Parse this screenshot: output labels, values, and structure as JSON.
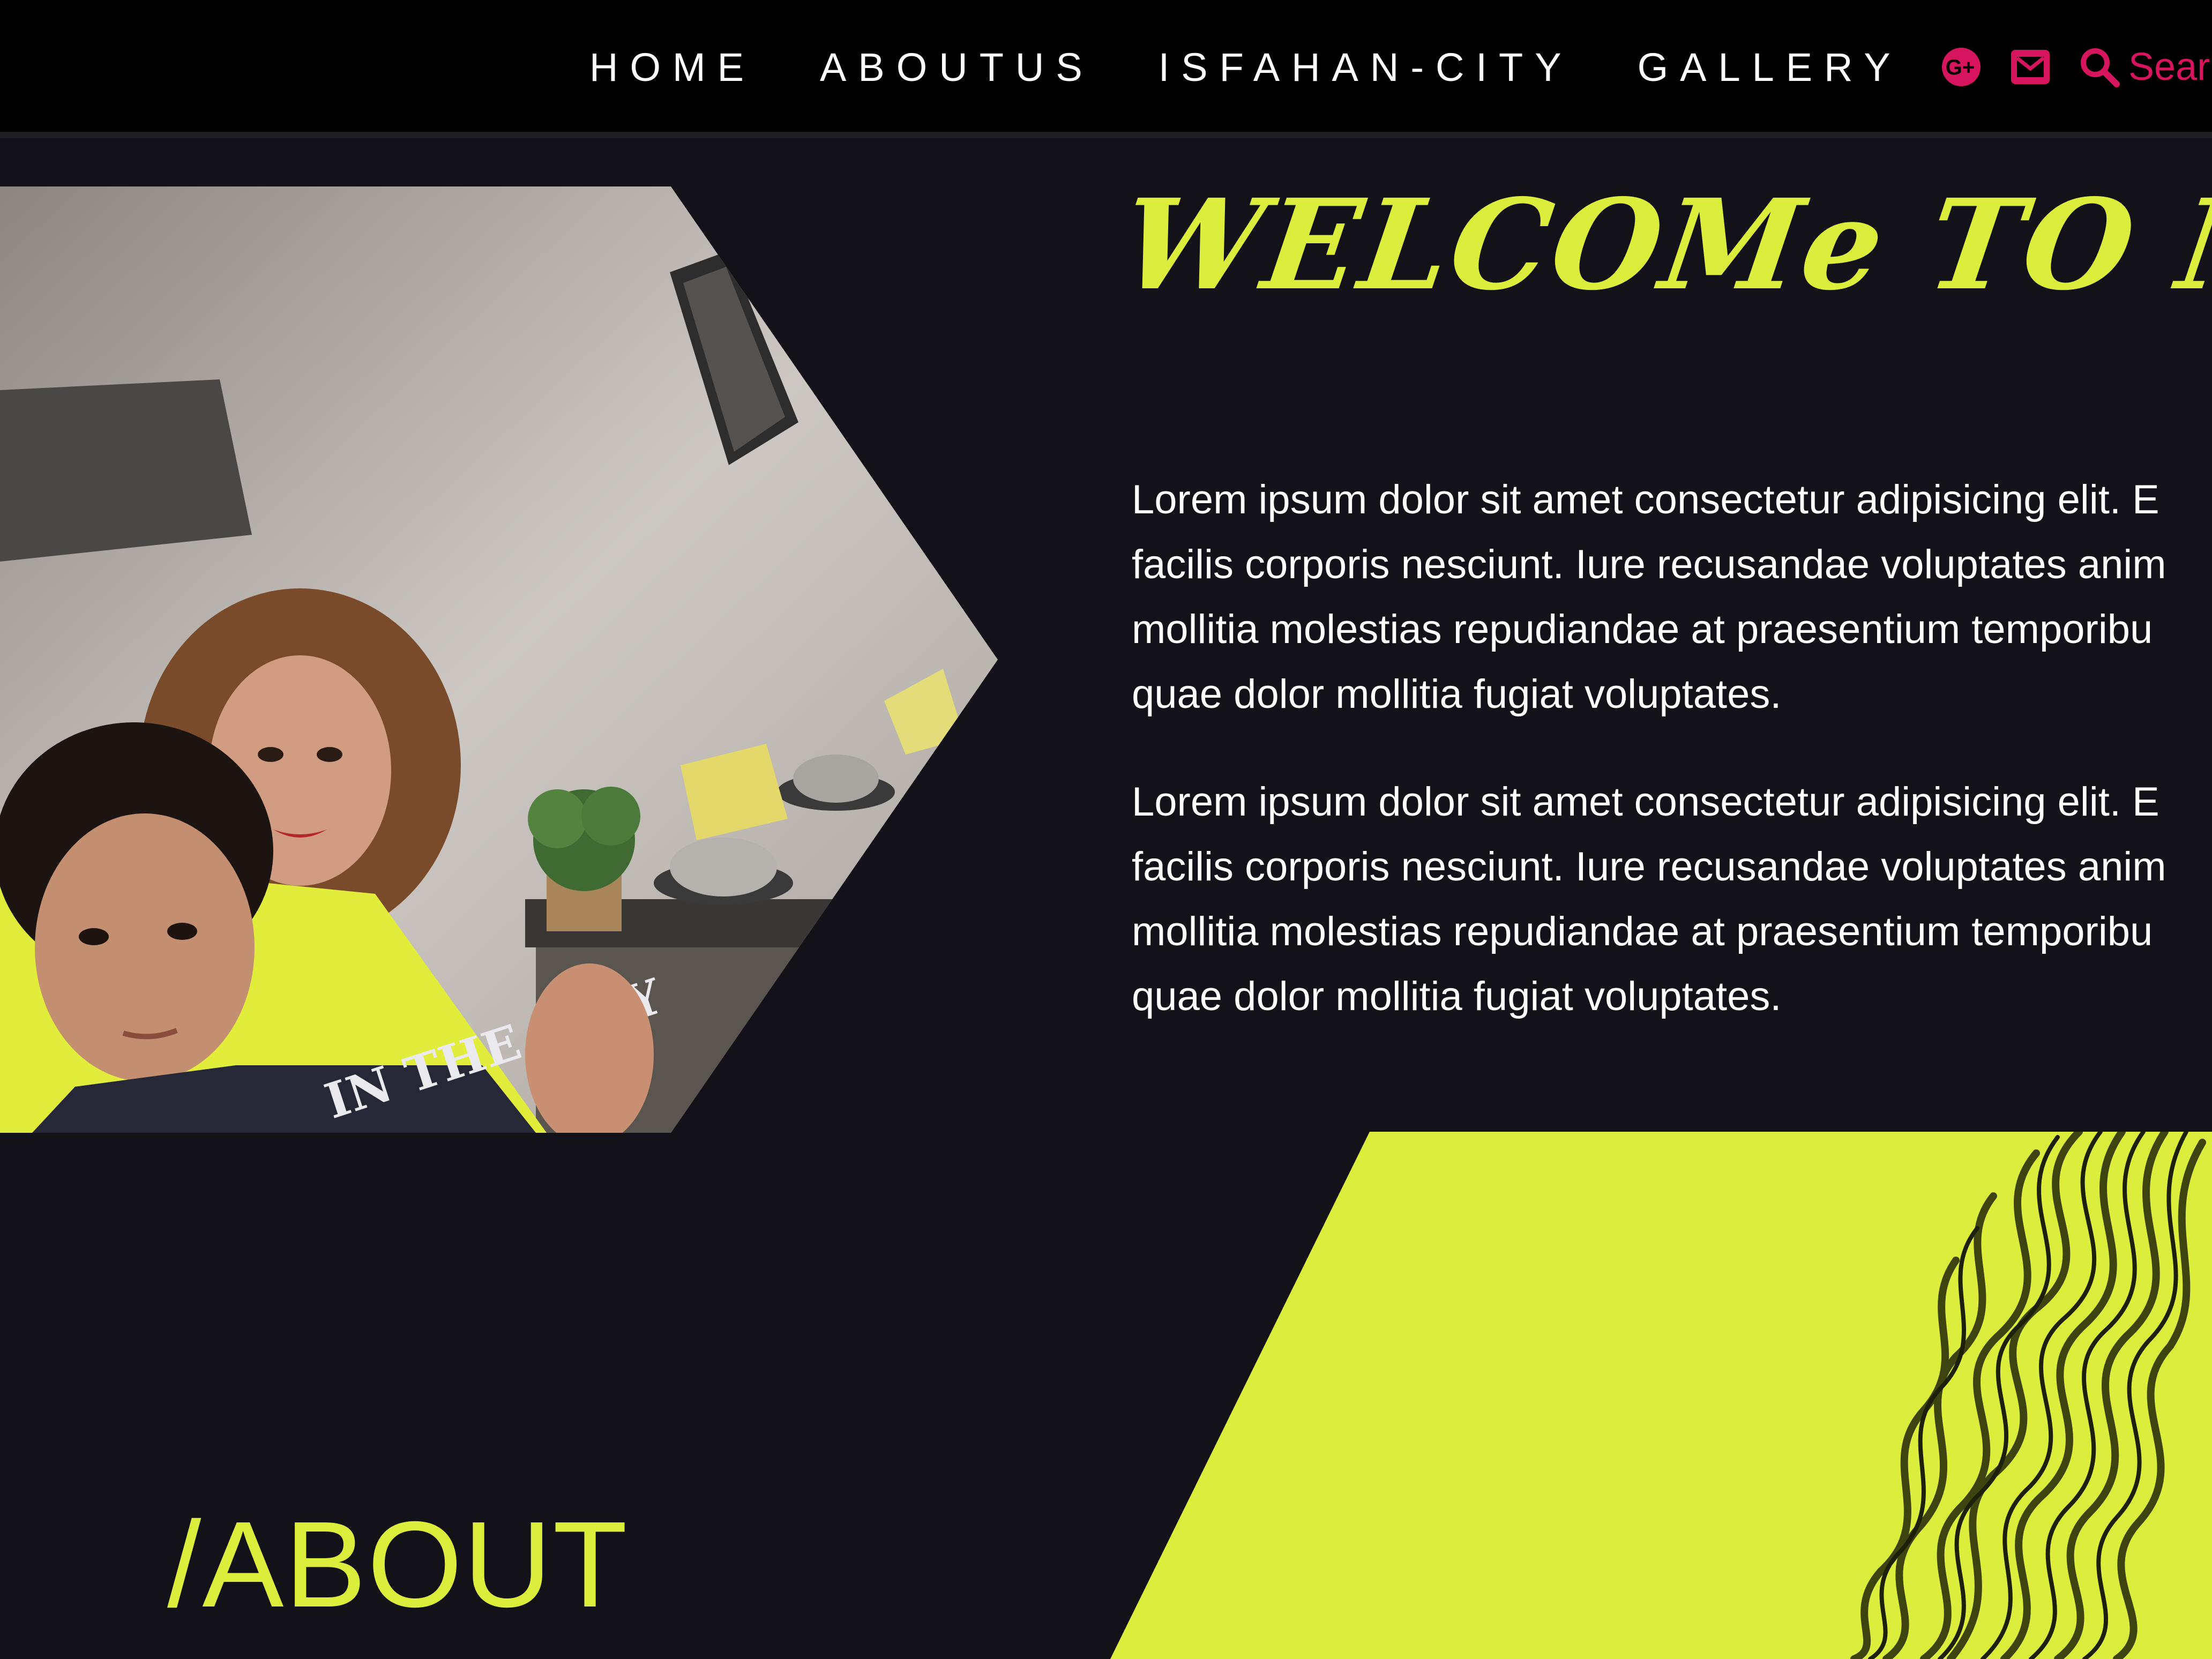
{
  "nav": {
    "links": [
      "HOME",
      "ABOUTUS",
      "ISFAHAN-CITY",
      "GALLERY"
    ],
    "search_label": "Sear",
    "icons": [
      "google-plus-icon",
      "mail-icon",
      "search-icon"
    ],
    "accent_color": "#d6155e"
  },
  "hero": {
    "title": "WELCOMe TO MY WEB S",
    "paragraphs": [
      [
        "Lorem ipsum dolor sit amet consectetur adipisicing elit. E",
        "facilis corporis nesciunt. Iure recusandae voluptates anim",
        "mollitia molestias repudiandae at praesentium temporibu",
        "quae dolor mollitia fugiat voluptates."
      ],
      [
        "Lorem ipsum dolor sit amet consectetur adipisicing elit. E",
        "facilis corporis nesciunt. Iure recusandae voluptates anim",
        "mollitia molestias repudiandae at praesentium temporibu",
        "quae dolor mollitia fugiat voluptates."
      ]
    ],
    "accent_color": "#dcee3c"
  },
  "about": {
    "heading": "/ABOUT"
  },
  "colors": {
    "background": "#131218",
    "navbar": "#000000",
    "lime": "#dcee3c",
    "pink": "#d6155e"
  }
}
